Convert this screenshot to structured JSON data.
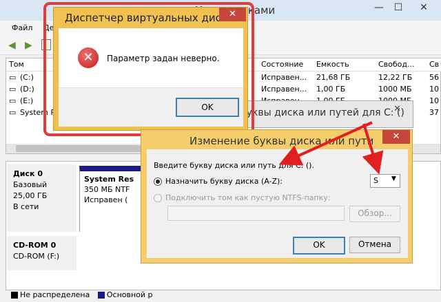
{
  "main_window": {
    "title": "Управление дисками",
    "title_visible": "Уп         ие дисками",
    "menu": [
      "Файл",
      "Де"
    ],
    "minimize": "—",
    "maximize": "☐",
    "close": "✕",
    "columns": [
      "Том",
      "Состояние",
      "Емкость",
      "Свобод...",
      "Св"
    ],
    "volumes": [
      {
        "name": "(C:)",
        "status": "Исправен...",
        "capacity": "21,68 ГБ",
        "free": "12,22 ГБ",
        "pct": "56"
      },
      {
        "name": "(D:)",
        "status": "Исправен...",
        "capacity": "1,00 ГБ",
        "free": "1000 МБ",
        "pct": "10"
      },
      {
        "name": "(E:)",
        "status": "Исправен...",
        "capacity": "1,00 ГБ",
        "free": "1000 МБ",
        "pct": "10"
      },
      {
        "name": "System R",
        "status": "Исправен...",
        "capacity": "",
        "free": "",
        "pct": "37"
      }
    ],
    "behind_dialog_title": "буквы диска или путей для C: ()",
    "disks": [
      {
        "label": "Диск 0",
        "type": "Базовый",
        "size": "25,00 ГБ",
        "state": "В сети",
        "partition": {
          "name": "System Res",
          "size": "350 МБ NTF",
          "status": "Исправен ("
        }
      },
      {
        "label": "CD-ROM 0",
        "type": "CD-ROM (F:)"
      }
    ],
    "legend": [
      {
        "label": "Не распределена",
        "color": "#000000"
      },
      {
        "label": "Основной р",
        "color": "#1a1a8c"
      }
    ]
  },
  "error_dialog": {
    "title": "Диспетчер виртуальных дисков",
    "close": "✕",
    "message": "Параметр задан неверно.",
    "ok": "OK",
    "icon": "error-icon"
  },
  "change_dialog": {
    "title": "Изменение буквы диска или пути",
    "close": "✕",
    "prompt": "Введите букву диска или путь для C: ().",
    "option_assign": "Назначить букву диска (A-Z):",
    "letter_value": "S",
    "option_mount": "Подключить том как пустую NTFS-папку:",
    "browse": "Обзор...",
    "ok": "OK",
    "cancel": "Отмена"
  },
  "colors": {
    "highlight_outline": "#e23b3b",
    "dialog_frame": "#f0c050",
    "arrow": "#e02020"
  }
}
